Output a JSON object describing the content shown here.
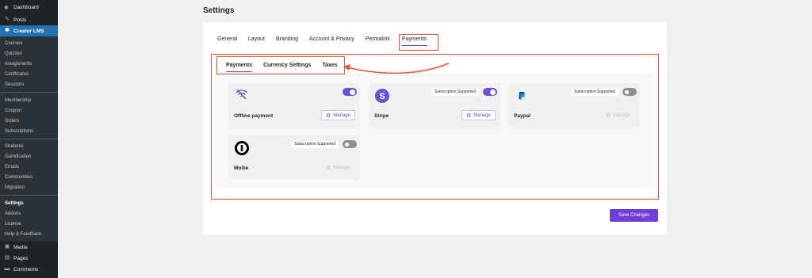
{
  "sidebar": {
    "top": {
      "label": "Dashboard",
      "icon": "dashboard-icon"
    },
    "main_items": [
      {
        "label": "Posts",
        "icon": "pin-icon"
      },
      {
        "label": "Creator LMS",
        "icon": "creator-lms-icon"
      }
    ],
    "sub_groups": [
      [
        "Courses",
        "Quizzes",
        "Assignments",
        "Certificates",
        "Sessions"
      ],
      [
        "Membership",
        "Coupon",
        "Orders",
        "Subscriptions"
      ],
      [
        "Students",
        "Gamification",
        "Emails",
        "Communities",
        "Migration"
      ],
      [
        "Settings",
        "Addons",
        "License",
        "Help & Feedback"
      ]
    ],
    "bottom_items": [
      {
        "label": "Media",
        "icon": "media-icon"
      },
      {
        "label": "Pages",
        "icon": "pages-icon"
      },
      {
        "label": "Comments",
        "icon": "comments-icon"
      }
    ],
    "current": "Settings",
    "accent": "#2271b1"
  },
  "page": {
    "title": "Settings"
  },
  "tabs": [
    "General",
    "Layout",
    "Branding",
    "Account & Privacy",
    "Permalink",
    "Payments"
  ],
  "active_tab": "Payments",
  "sub_tabs": [
    "Payments",
    "Currency Settings",
    "Taxes"
  ],
  "active_sub_tab": "Payments",
  "gateways": [
    {
      "name": "Offline payment",
      "icon": "wifi-icon",
      "subscription_badge": "",
      "enabled": true,
      "manage_label": "Manage",
      "manage_enabled": true
    },
    {
      "name": "Stripe",
      "icon": "stripe-logo-icon",
      "subscription_badge": "Subscription Supported",
      "enabled": true,
      "manage_label": "Manage",
      "manage_enabled": true
    },
    {
      "name": "Paypal",
      "icon": "paypal-logo-icon",
      "subscription_badge": "Subscription Supported",
      "enabled": false,
      "manage_label": "Manage",
      "manage_enabled": false
    },
    {
      "name": "Mollie",
      "icon": "mollie-logo-icon",
      "subscription_badge": "Subscription Supported",
      "enabled": false,
      "manage_label": "Manage",
      "manage_enabled": false
    }
  ],
  "save_label": "Save Changes",
  "colors": {
    "primary": "#6d3fd8",
    "highlight": "#e8593a",
    "toggle_on": "#6b4fd8"
  }
}
